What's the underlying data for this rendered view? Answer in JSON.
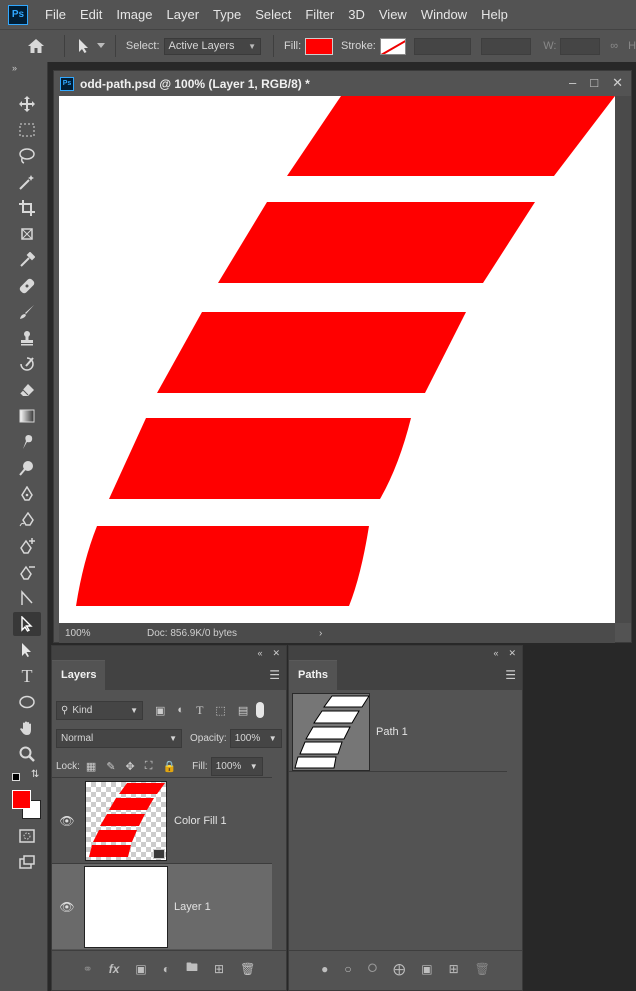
{
  "app": {
    "logo": "Ps"
  },
  "menu": [
    "File",
    "Edit",
    "Image",
    "Layer",
    "Type",
    "Select",
    "Filter",
    "3D",
    "View",
    "Window",
    "Help"
  ],
  "options": {
    "select_label": "Select:",
    "select_value": "Active Layers",
    "fill_label": "Fill:",
    "fill_color": "#ff0000",
    "stroke_label": "Stroke:",
    "w_label": "W:"
  },
  "toolbar": {
    "fg_color": "#ff0000",
    "bg_color": "#ffffff"
  },
  "document": {
    "title": "odd-path.psd @ 100% (Layer 1, RGB/8) *",
    "zoom": "100%",
    "doc_info": "Doc: 856.9K/0 bytes",
    "shape_color": "#ff0000"
  },
  "layers_panel": {
    "tab": "Layers",
    "kind_label": "Kind",
    "blend_mode": "Normal",
    "opacity_label": "Opacity:",
    "opacity": "100%",
    "lock_label": "Lock:",
    "fill_label": "Fill:",
    "fill": "100%",
    "layers": [
      {
        "name": "Color Fill 1"
      },
      {
        "name": "Layer 1"
      }
    ]
  },
  "paths_panel": {
    "tab": "Paths",
    "paths": [
      {
        "name": "Path 1"
      }
    ]
  }
}
